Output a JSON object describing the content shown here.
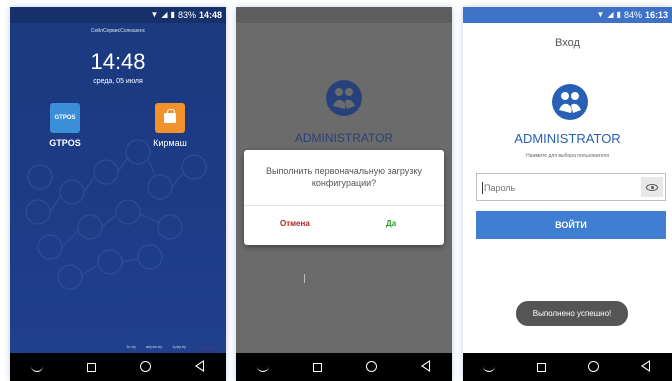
{
  "screen1": {
    "status": {
      "battery": "83%",
      "time": "14:48"
    },
    "carrier": "СейлСервисСолюшенс",
    "clock": "14:48",
    "date": "среда, 05 июля",
    "apps": [
      {
        "label": "GTPOS",
        "tile_text": "GTPOS",
        "color": "#3b8fd6"
      },
      {
        "label": "Кирмаш",
        "color": "#f2922d"
      }
    ],
    "links": [
      "3c.by",
      "artpos.by",
      "1pay.by"
    ]
  },
  "screen2": {
    "user_name": "ADMINISTRATOR",
    "dialog": {
      "message": "Выполнить первоначальную загрузку конфигурации?",
      "cancel_label": "Отмена",
      "ok_label": "Да"
    }
  },
  "screen3": {
    "status": {
      "battery": "84%",
      "time": "16:13"
    },
    "header": "Вход",
    "user_name": "ADMINISTRATOR",
    "hint": "Нажмите для выбора пользователя",
    "password_placeholder": "Пароль",
    "login_label": "ВОЙТИ",
    "toast": "Выполнено успешно!"
  },
  "colors": {
    "home_bg": "#1d3b85",
    "accent_blue": "#3f7ed0",
    "cancel_red": "#b02525",
    "ok_green": "#2c9d2c"
  },
  "icons": [
    "wifi-icon",
    "signal-icon",
    "battery-icon",
    "shopping-bag-icon",
    "users-logo-icon",
    "eye-icon",
    "nav-menu-icon",
    "nav-recents-icon",
    "nav-home-icon",
    "nav-back-icon"
  ]
}
